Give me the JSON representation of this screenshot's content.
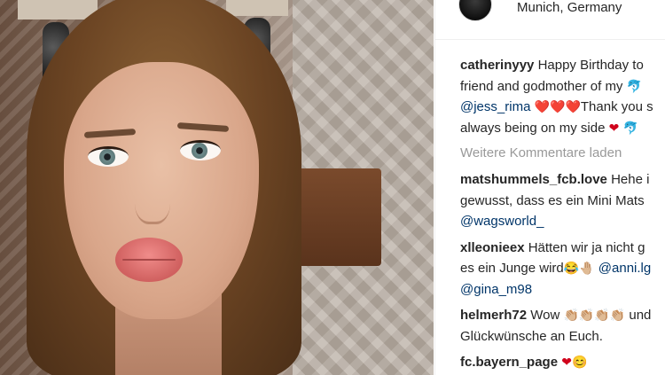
{
  "post": {
    "location": "Munich, Germany"
  },
  "caption": {
    "username": "catherinyyy",
    "lines": [
      "Happy Birthday to",
      "friend and godmother of my",
      "Thank you s",
      "always being on my side"
    ],
    "mention": "@jess_rima",
    "emojis": [
      "❤️‍🔥",
      "❤",
      "🐬"
    ]
  },
  "load_more": "Weitere Kommentare laden",
  "comments": [
    {
      "username": "matshummels_fcb.love",
      "lines": [
        "Hehe i",
        "gewusst, dass es ein Mini Mats"
      ],
      "mention": "@wagsworld_"
    },
    {
      "username": "xlleonieex",
      "lines": [
        "Hätten wir ja nicht g",
        "es ein Junge wird"
      ],
      "mentions": [
        "@anni.lg",
        "@gina_m98"
      ]
    },
    {
      "username": "helmerh72",
      "lines": [
        "Wow",
        "und",
        "Glückwünsche an Euch."
      ]
    },
    {
      "username": "fc.bayern_page",
      "lines": [
        ""
      ]
    }
  ],
  "colors": {
    "text": "#262626",
    "mention": "#003569",
    "muted": "#999999",
    "heart": "#ed4956"
  }
}
